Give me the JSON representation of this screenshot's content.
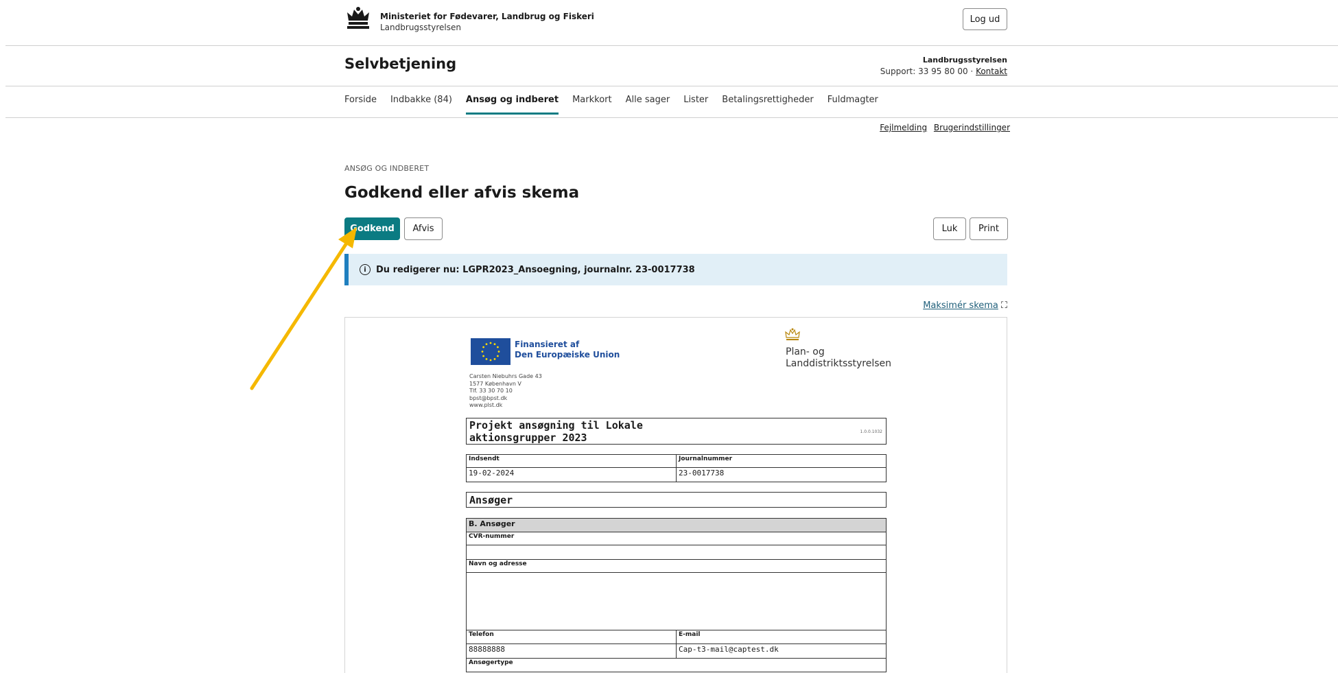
{
  "header": {
    "ministry_name": "Ministeriet for Fødevarer, Landbrug og Fiskeri",
    "ministry_sub": "Landbrugsstyrelsen",
    "logout_label": "Log ud",
    "site_title": "Selvbetjening",
    "org_name": "Landbrugsstyrelsen",
    "support_text": "Support: 33 95 80 00 · ",
    "contact_link": "Kontakt"
  },
  "nav": {
    "items": [
      {
        "label": "Forside"
      },
      {
        "label": "Indbakke (84)"
      },
      {
        "label": "Ansøg og indberet"
      },
      {
        "label": "Markkort"
      },
      {
        "label": "Alle sager"
      },
      {
        "label": "Lister"
      },
      {
        "label": "Betalingsrettigheder"
      },
      {
        "label": "Fuldmagter"
      }
    ],
    "active_index": 2
  },
  "utility_links": {
    "error_report": "Fejlmelding",
    "user_settings": "Brugerindstillinger"
  },
  "page": {
    "breadcrumb": "ANSØG OG INDBERET",
    "title": "Godkend eller afvis skema",
    "approve_label": "Godkend",
    "reject_label": "Afvis",
    "close_label": "Luk",
    "print_label": "Print",
    "info_icon": "info-circle-icon",
    "info_text": "Du redigerer nu: LGPR2023_Ansoegning, journalnr. 23-0017738",
    "maximize_link": "Maksimér skema",
    "maximize_icon": "expand-icon",
    "primary_color": "#0b7b82",
    "info_border_color": "#1f7fbf",
    "annotation_arrow_color": "#f5b800"
  },
  "document": {
    "eu_line1": "Finansieret af",
    "eu_line2": "Den Europæiske Union",
    "agency_line1": "Plan- og",
    "agency_line2": "Landdistriktsstyrelsen",
    "address": [
      "Carsten Niebuhrs Gade 43",
      "1577 København V",
      "Tlf. 33 30 70 10",
      "bpst@bpst.dk",
      "www.plst.dk"
    ],
    "form_title_line1": "Projekt ansøgning til Lokale",
    "form_title_line2": "aktionsgrupper 2023",
    "form_version": "1.0.0.1032",
    "submitted_label": "Indsendt",
    "submitted_value": "19-02-2024",
    "journal_label": "Journalnummer",
    "journal_value": "23-0017738",
    "section_applicant": "Ansøger",
    "subsection_b": "B. Ansøger",
    "cvr_label": "CVR-nummer",
    "name_address_label": "Navn og adresse",
    "phone_label": "Telefon",
    "phone_value": "88888888",
    "email_label": "E-mail",
    "email_value": "Cap-t3-mail@captest.dk",
    "applicant_type_label": "Ansøgertype"
  }
}
